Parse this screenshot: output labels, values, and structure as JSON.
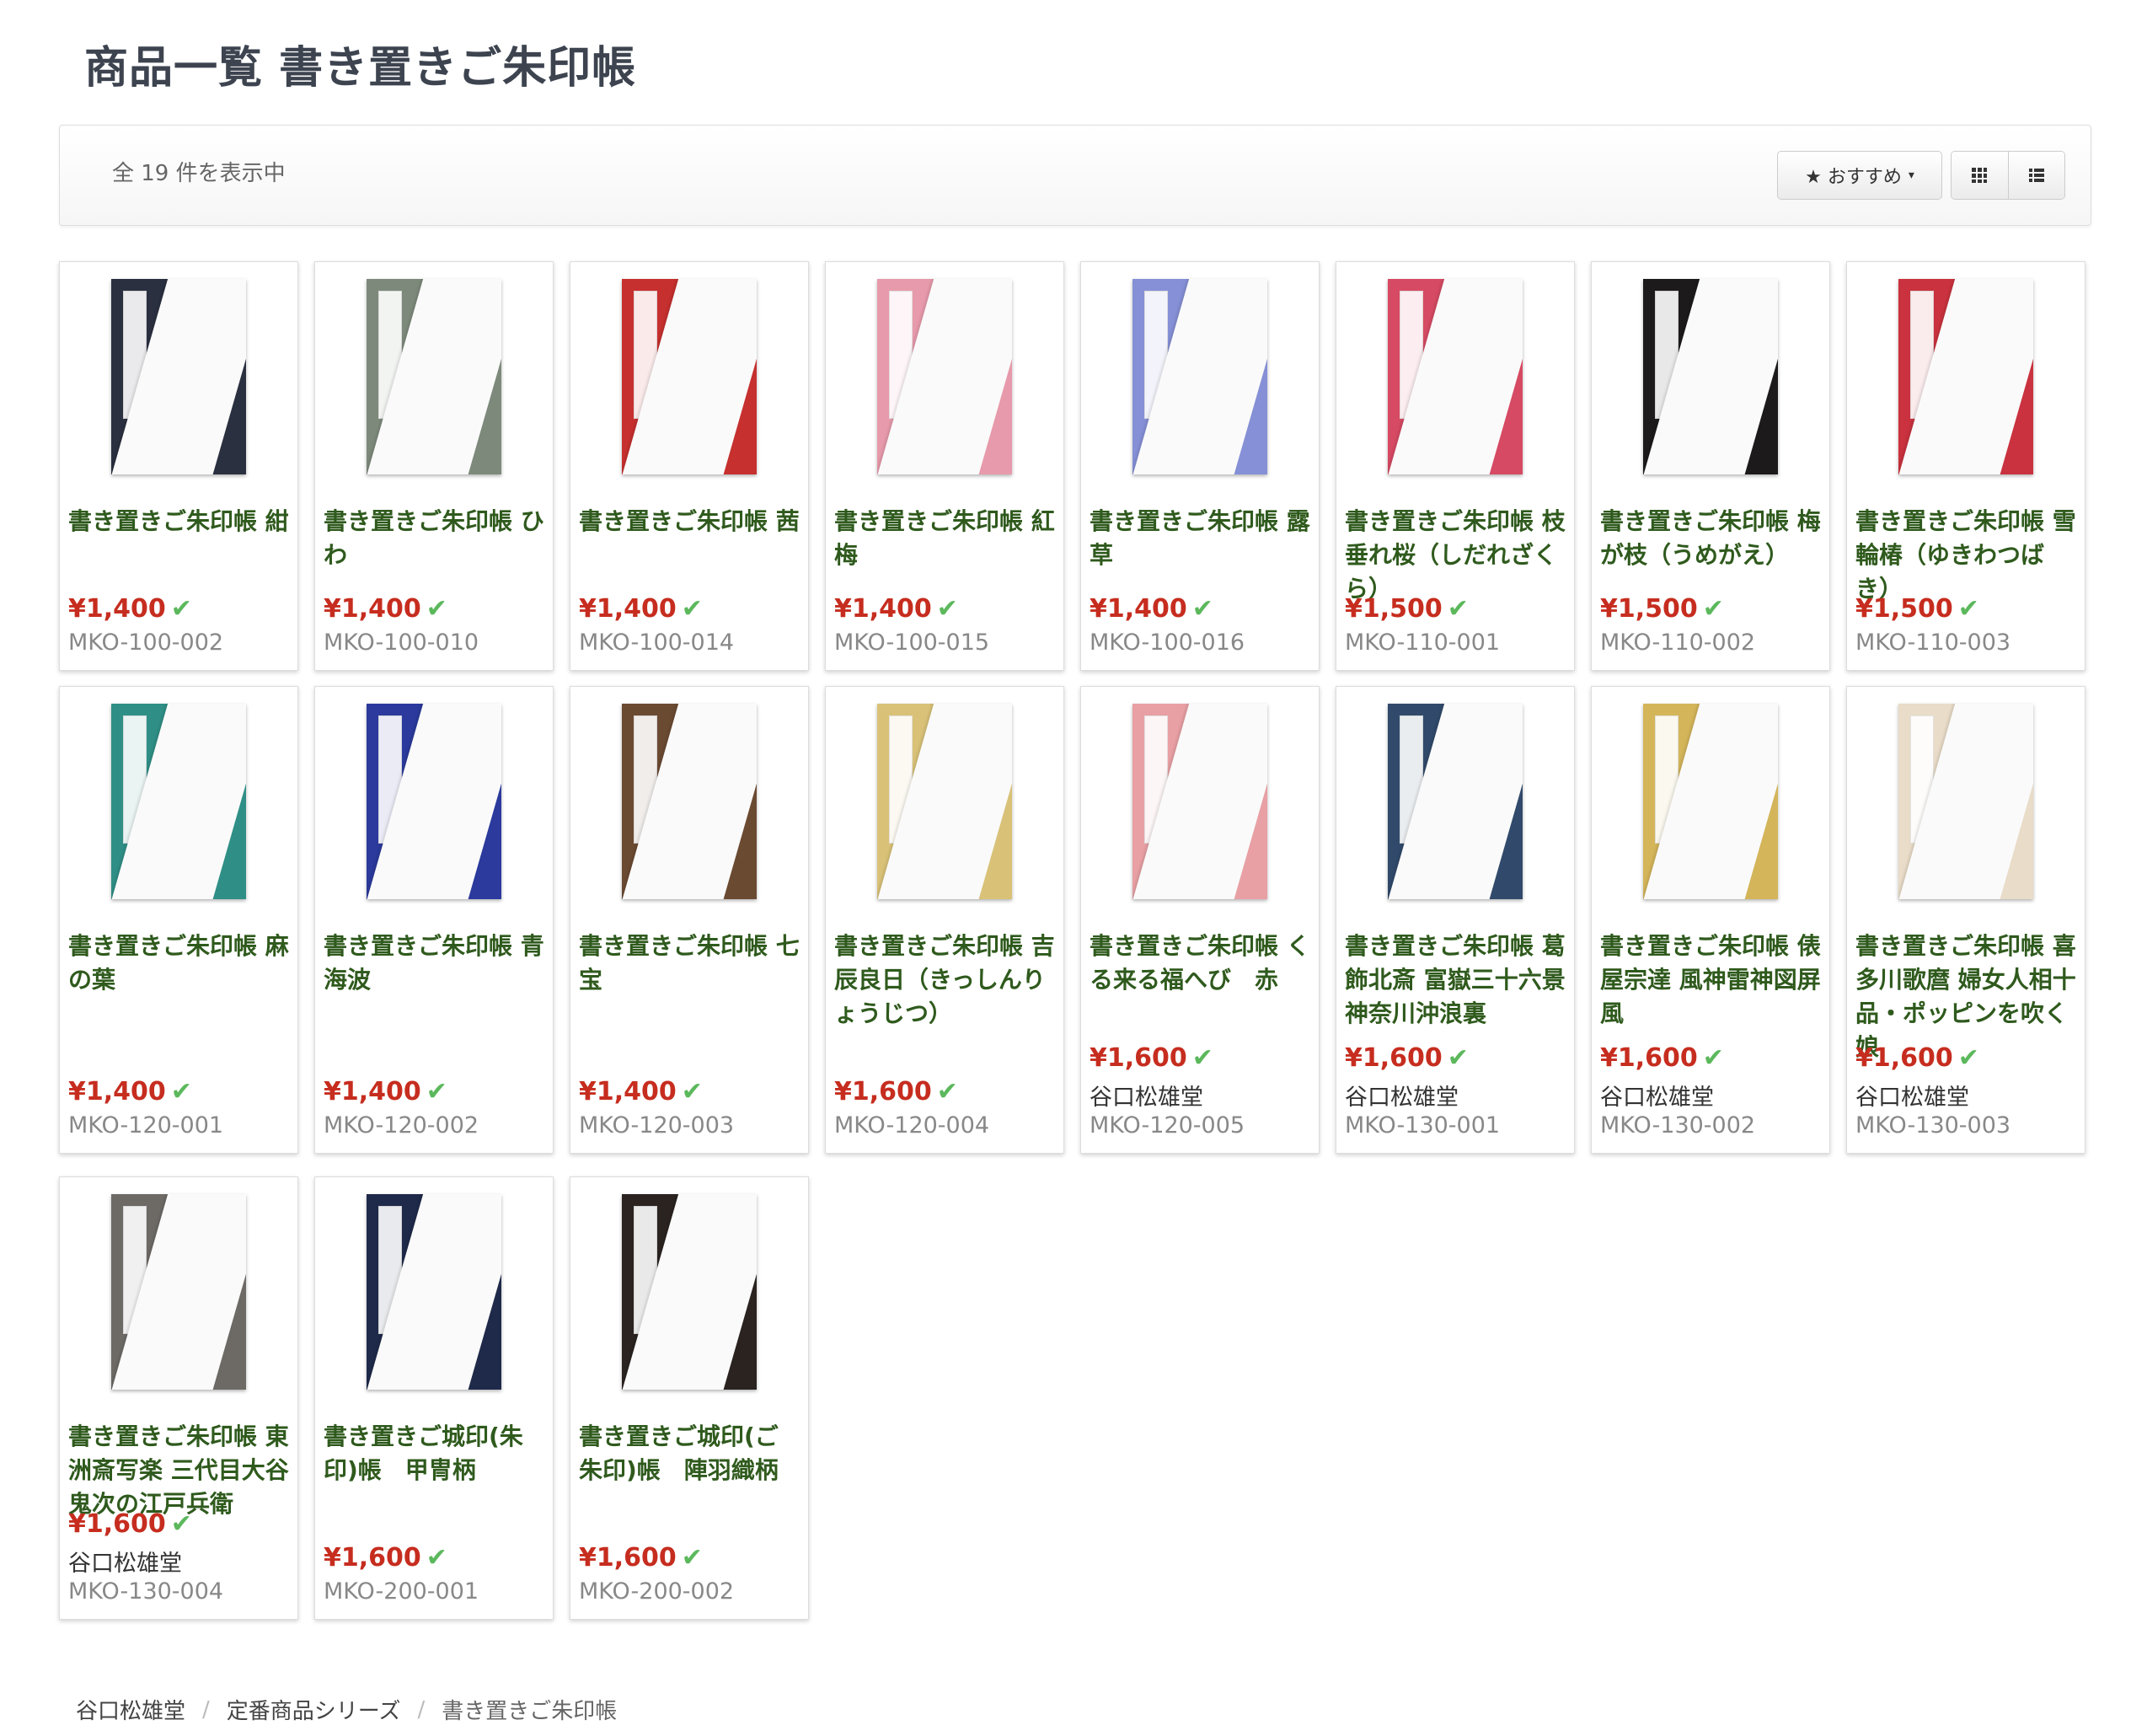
{
  "page_title": "商品一覧 書き置きご朱印帳",
  "toolbar": {
    "count_text": "全 19 件を表示中",
    "sort_label": "★ おすすめ",
    "sort_caret": "▾",
    "grid_icon": "grid-icon",
    "list_icon": "list-icon"
  },
  "colors": {
    "accent_green": "#2f5a1d",
    "price_red": "#c62d1f",
    "check_green": "#5cb85c"
  },
  "products": [
    {
      "name": "書き置きご朱印帳 紺",
      "price": "¥1,400",
      "maker": "",
      "code": "MKO-100-002",
      "cover": "#2b3040"
    },
    {
      "name": "書き置きご朱印帳 ひわ",
      "price": "¥1,400",
      "maker": "",
      "code": "MKO-100-010",
      "cover": "#7d8a7b"
    },
    {
      "name": "書き置きご朱印帳 茜",
      "price": "¥1,400",
      "maker": "",
      "code": "MKO-100-014",
      "cover": "#c6302f"
    },
    {
      "name": "書き置きご朱印帳 紅梅",
      "price": "¥1,400",
      "maker": "",
      "code": "MKO-100-015",
      "cover": "#e79aab"
    },
    {
      "name": "書き置きご朱印帳 露草",
      "price": "¥1,400",
      "maker": "",
      "code": "MKO-100-016",
      "cover": "#8590d6"
    },
    {
      "name": "書き置きご朱印帳 枝垂れ桜（しだれざくら）",
      "price": "¥1,500",
      "maker": "",
      "code": "MKO-110-001",
      "cover": "#d64a63"
    },
    {
      "name": "書き置きご朱印帳 梅が枝（うめがえ）",
      "price": "¥1,500",
      "maker": "",
      "code": "MKO-110-002",
      "cover": "#1d1a1b"
    },
    {
      "name": "書き置きご朱印帳 雪輪椿（ゆきわつばき）",
      "price": "¥1,500",
      "maker": "",
      "code": "MKO-110-003",
      "cover": "#c9323e"
    },
    {
      "name": "書き置きご朱印帳 麻の葉",
      "price": "¥1,400",
      "maker": "",
      "code": "MKO-120-001",
      "cover": "#2f8f86"
    },
    {
      "name": "書き置きご朱印帳 青海波",
      "price": "¥1,400",
      "maker": "",
      "code": "MKO-120-002",
      "cover": "#2b3a9c"
    },
    {
      "name": "書き置きご朱印帳 七宝",
      "price": "¥1,400",
      "maker": "",
      "code": "MKO-120-003",
      "cover": "#6b4a32"
    },
    {
      "name": "書き置きご朱印帳 吉辰良日（きっしんりょうじつ）",
      "price": "¥1,600",
      "maker": "",
      "code": "MKO-120-004",
      "cover": "#d9c278"
    },
    {
      "name": "書き置きご朱印帳 くる来る福へび　赤",
      "price": "¥1,600",
      "maker": "谷口松雄堂",
      "code": "MKO-120-005",
      "cover": "#e8a0a4"
    },
    {
      "name": "書き置きご朱印帳 葛飾北斎 富嶽三十六景　神奈川沖浪裏",
      "price": "¥1,600",
      "maker": "谷口松雄堂",
      "code": "MKO-130-001",
      "cover": "#314a6b"
    },
    {
      "name": "書き置きご朱印帳 俵屋宗達 風神雷神図屏風",
      "price": "¥1,600",
      "maker": "谷口松雄堂",
      "code": "MKO-130-002",
      "cover": "#d4b55a"
    },
    {
      "name": "書き置きご朱印帳 喜多川歌麿 婦女人相十品・ポッピンを吹く娘",
      "price": "¥1,600",
      "maker": "谷口松雄堂",
      "code": "MKO-130-003",
      "cover": "#e9dcc8"
    },
    {
      "name": "書き置きご朱印帳 東洲斎写楽 三代目大谷鬼次の江戸兵衛",
      "price": "¥1,600",
      "maker": "谷口松雄堂",
      "code": "MKO-130-004",
      "cover": "#6d6a66"
    },
    {
      "name": "書き置きご城印(朱印)帳　甲冑柄",
      "price": "¥1,600",
      "maker": "",
      "code": "MKO-200-001",
      "cover": "#1f2a4a"
    },
    {
      "name": "書き置きご城印(ご朱印)帳　陣羽織柄",
      "price": "¥1,600",
      "maker": "",
      "code": "MKO-200-002",
      "cover": "#2a2320"
    }
  ],
  "breadcrumb": {
    "items": [
      "谷口松雄堂",
      "定番商品シリーズ"
    ],
    "current": "書き置きご朱印帳",
    "separator": "/"
  }
}
